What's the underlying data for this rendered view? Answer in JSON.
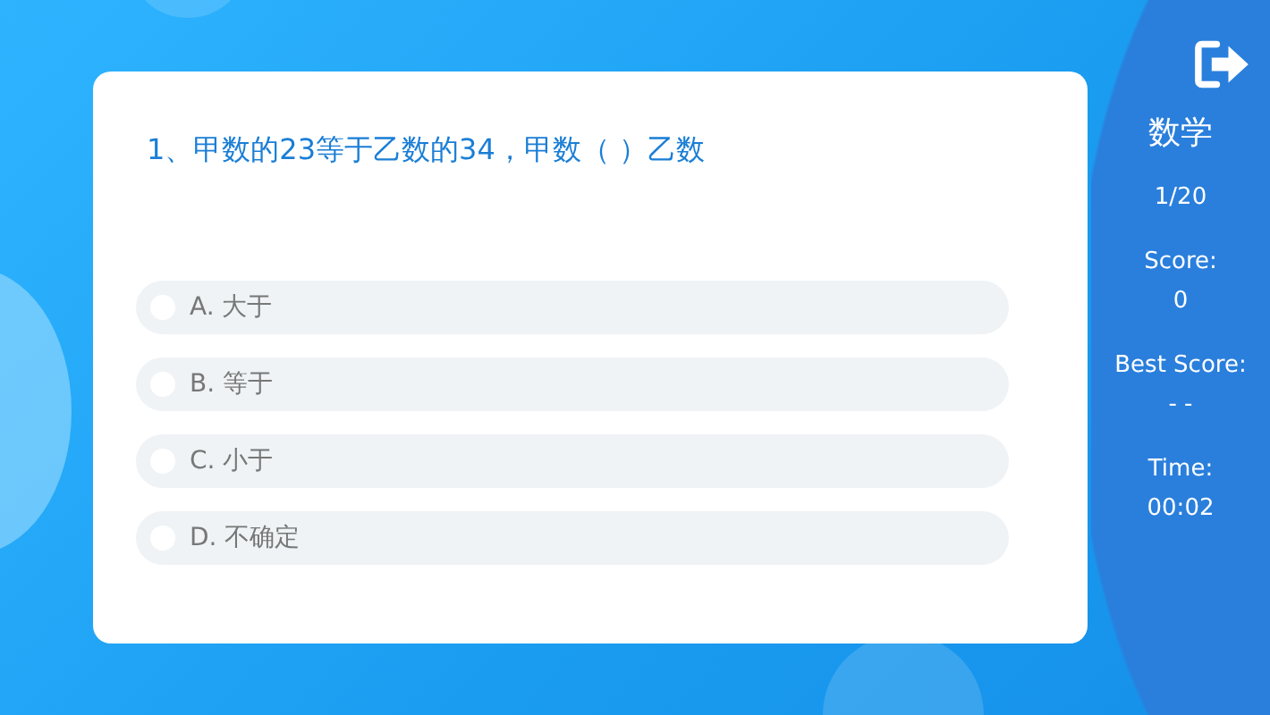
{
  "question": {
    "text": "1、甲数的23等于乙数的34，甲数（ ）乙数"
  },
  "options": [
    {
      "label": "A. 大于",
      "selected": false
    },
    {
      "label": "B. 等于",
      "selected": false
    },
    {
      "label": "C. 小于",
      "selected": false
    },
    {
      "label": "D. 不确定",
      "selected": false
    }
  ],
  "sidebar": {
    "subject": "数学",
    "progress": "1/20",
    "score_label": "Score:",
    "score": "0",
    "best_label": "Best Score:",
    "best": "- -",
    "time_label": "Time:",
    "time": "00:02"
  }
}
